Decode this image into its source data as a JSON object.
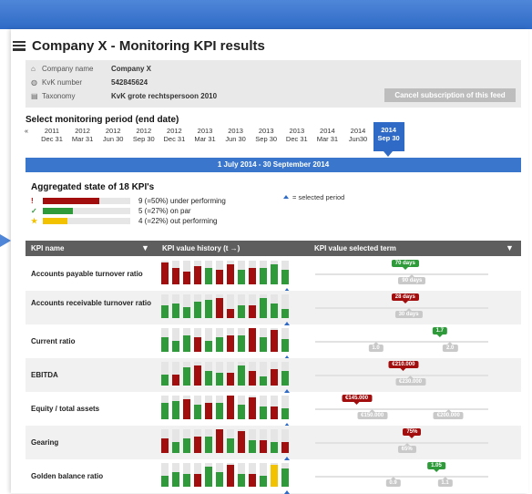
{
  "header": {
    "title": "Company X - Monitoring KPI results"
  },
  "company": {
    "rows": [
      {
        "icon": "home-icon",
        "label": "Company name",
        "value": "Company X"
      },
      {
        "icon": "globe-icon",
        "label": "KvK number",
        "value": "542845624"
      },
      {
        "icon": "document-icon",
        "label": "Taxonomy",
        "value": "KvK grote rechtspersoon 2010"
      }
    ],
    "cancel_label": "Cancel subscription of this feed"
  },
  "period": {
    "title": "Select monitoring period (end date)",
    "prev_label": "«",
    "items": [
      {
        "year": "2011",
        "date": "Dec 31"
      },
      {
        "year": "2012",
        "date": "Mar 31"
      },
      {
        "year": "2012",
        "date": "Jun 30"
      },
      {
        "year": "2012",
        "date": "Sep 30"
      },
      {
        "year": "2012",
        "date": "Dec 31"
      },
      {
        "year": "2013",
        "date": "Mar 31"
      },
      {
        "year": "2013",
        "date": "Jun 30"
      },
      {
        "year": "2013",
        "date": "Sep 30"
      },
      {
        "year": "2013",
        "date": "Dec 31"
      },
      {
        "year": "2014",
        "date": "Mar 31"
      },
      {
        "year": "2014",
        "date": "Jun30"
      },
      {
        "year": "2014",
        "date": "Sep 30"
      }
    ],
    "selected_index": 11,
    "range_label": "1 July 2014 - 30 September 2014"
  },
  "aggregate": {
    "title": "Aggregated state of 18 KPI's",
    "rows": [
      {
        "symbol": "!",
        "color": "#a20e0e",
        "fraction": 0.5,
        "text": "9 (=50%) under performing"
      },
      {
        "symbol": "✓",
        "color": "#2e9a3a",
        "fraction": 0.27,
        "text": "5 (=27%) on par"
      },
      {
        "symbol": "★",
        "color": "#f2c200",
        "fraction": 0.22,
        "text": "4 (=22%) out performing"
      }
    ],
    "legend_note": "= selected period"
  },
  "table": {
    "col_kpi": "KPI name",
    "col_history": "KPI value history (t →)",
    "col_selected": "KPI value selected term",
    "rows": [
      {
        "name": "Accounts payable turnover ratio",
        "history": [
          "r",
          "r",
          "r",
          "r",
          "g",
          "r",
          "r",
          "g",
          "r",
          "g",
          "g",
          "g"
        ],
        "markers": [
          {
            "kind": "green",
            "pos": 0.52,
            "label": "70 days"
          },
          {
            "kind": "gray",
            "pos": 0.56,
            "label": "90 days"
          }
        ]
      },
      {
        "name": "Accounts receivable turnover ratio",
        "history": [
          "g",
          "g",
          "g",
          "g",
          "g",
          "r",
          "r",
          "g",
          "r",
          "g",
          "g",
          "g"
        ],
        "markers": [
          {
            "kind": "red",
            "pos": 0.52,
            "label": "28 days"
          },
          {
            "kind": "gray",
            "pos": 0.54,
            "label": "30 days"
          }
        ]
      },
      {
        "name": "Current ratio",
        "history": [
          "g",
          "g",
          "g",
          "r",
          "g",
          "g",
          "r",
          "g",
          "r",
          "g",
          "r",
          "g"
        ],
        "markers": [
          {
            "kind": "green",
            "pos": 0.72,
            "label": "1.7"
          },
          {
            "kind": "gray",
            "pos": 0.35,
            "label": "1.0"
          },
          {
            "kind": "gray",
            "pos": 0.78,
            "label": "2.0"
          }
        ]
      },
      {
        "name": "EBITDA",
        "history": [
          "g",
          "r",
          "g",
          "r",
          "g",
          "g",
          "r",
          "g",
          "r",
          "g",
          "r",
          "g"
        ],
        "markers": [
          {
            "kind": "red",
            "pos": 0.51,
            "label": "€210.000"
          },
          {
            "kind": "gray",
            "pos": 0.55,
            "label": "€230.000"
          }
        ]
      },
      {
        "name": "Equity / total assets",
        "history": [
          "g",
          "g",
          "r",
          "g",
          "r",
          "g",
          "r",
          "g",
          "r",
          "g",
          "r",
          "g"
        ],
        "markers": [
          {
            "kind": "red",
            "pos": 0.24,
            "label": "€145.000"
          },
          {
            "kind": "gray",
            "pos": 0.33,
            "label": "€150.000"
          },
          {
            "kind": "gray",
            "pos": 0.77,
            "label": "€200.000"
          }
        ]
      },
      {
        "name": "Gearing",
        "history": [
          "r",
          "g",
          "g",
          "r",
          "g",
          "r",
          "g",
          "r",
          "g",
          "r",
          "g",
          "r"
        ],
        "markers": [
          {
            "kind": "red",
            "pos": 0.56,
            "label": "75%"
          },
          {
            "kind": "gray",
            "pos": 0.53,
            "label": "65%"
          }
        ]
      },
      {
        "name": "Golden balance ratio",
        "history": [
          "g",
          "g",
          "g",
          "r",
          "g",
          "g",
          "r",
          "g",
          "r",
          "g",
          "y",
          "g"
        ],
        "markers": [
          {
            "kind": "green",
            "pos": 0.7,
            "label": "1.05"
          },
          {
            "kind": "gray",
            "pos": 0.45,
            "label": "0.9"
          },
          {
            "kind": "gray",
            "pos": 0.75,
            "label": "1.1"
          }
        ]
      }
    ]
  },
  "colors": {
    "accent": "#2f6bc6",
    "under": "#a20e0e",
    "par": "#2e9a3a",
    "out": "#f2c200"
  }
}
